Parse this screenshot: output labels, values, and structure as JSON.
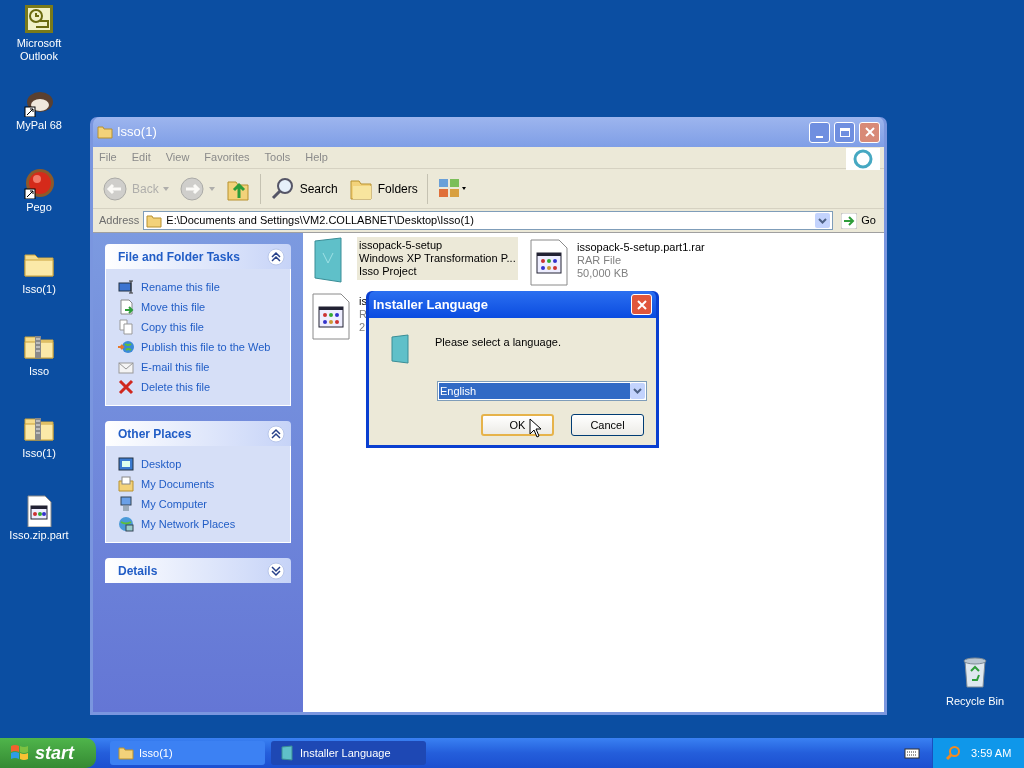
{
  "desktop_icons": [
    {
      "label": "Microsoft Outlook",
      "kind": "outlook"
    },
    {
      "label": "MyPal 68",
      "kind": "mypal"
    },
    {
      "label": "Pego",
      "kind": "pego"
    },
    {
      "label": "Isso(1)",
      "kind": "folder"
    },
    {
      "label": "Isso",
      "kind": "zip"
    },
    {
      "label": "Isso(1)",
      "kind": "zip"
    },
    {
      "label": "Isso.zip.part",
      "kind": "file"
    }
  ],
  "recycle_bin": {
    "label": "Recycle Bin"
  },
  "window": {
    "title": "Isso(1)",
    "menu": [
      "File",
      "Edit",
      "View",
      "Favorites",
      "Tools",
      "Help"
    ],
    "toolbar": [
      {
        "kind": "back",
        "label": "Back",
        "disabled": true
      },
      {
        "kind": "forward",
        "disabled": true
      },
      {
        "kind": "up",
        "disabled": false
      },
      {
        "kind": "search",
        "label": "Search",
        "disabled": false
      },
      {
        "kind": "folders",
        "label": "Folders",
        "disabled": false
      },
      {
        "kind": "views",
        "disabled": false
      }
    ],
    "address": {
      "label": "Address",
      "value": "E:\\Documents and Settings\\VM2.COLLABNET\\Desktop\\Isso(1)",
      "go": "Go"
    },
    "task_panels": [
      {
        "title": "File and Folder Tasks",
        "expanded": true,
        "items": [
          {
            "label": "Rename this file",
            "kind": "rename"
          },
          {
            "label": "Move this file",
            "kind": "move"
          },
          {
            "label": "Copy this file",
            "kind": "copy"
          },
          {
            "label": "Publish this file to the Web",
            "kind": "publish"
          },
          {
            "label": "E-mail this file",
            "kind": "email"
          },
          {
            "label": "Delete this file",
            "kind": "delete"
          }
        ]
      },
      {
        "title": "Other Places",
        "expanded": true,
        "items": [
          {
            "label": "Desktop",
            "kind": "desktop"
          },
          {
            "label": "My Documents",
            "kind": "documents"
          },
          {
            "label": "My Computer",
            "kind": "computer"
          },
          {
            "label": "My Network Places",
            "kind": "network"
          }
        ]
      },
      {
        "title": "Details",
        "expanded": false
      }
    ],
    "files": [
      {
        "kind": "installer",
        "selected": true,
        "lines": [
          "issopack-5-setup",
          "Windows XP Transformation P...",
          "Isso Project"
        ]
      },
      {
        "kind": "rar",
        "selected": false,
        "lines": [
          "issopack-5-setup.part1.rar",
          "RAR File",
          "50,000 KB"
        ]
      },
      {
        "kind": "rar",
        "selected": false,
        "lines": [
          "is",
          "R",
          "2"
        ]
      }
    ]
  },
  "dialog": {
    "title": "Installer Language",
    "message": "Please select a language.",
    "language": "English",
    "buttons": [
      {
        "label": "OK",
        "default": true
      },
      {
        "label": "Cancel",
        "default": false
      }
    ]
  },
  "taskbar": {
    "start": "start",
    "tasks": [
      {
        "label": "Isso(1)",
        "kind": "folder",
        "selected": false
      },
      {
        "label": "Installer Language",
        "kind": "installer",
        "selected": true
      }
    ],
    "clock": "3:59 AM"
  }
}
